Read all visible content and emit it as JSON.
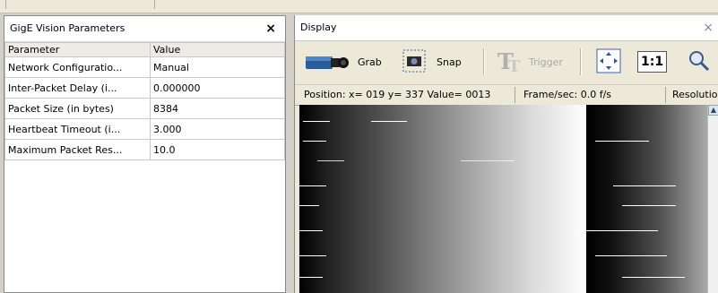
{
  "left_panel": {
    "title": "GigE Vision Parameters",
    "close_glyph": "×",
    "columns": [
      "Parameter",
      "Value"
    ],
    "rows": [
      {
        "param": "Network Configuratio...",
        "value": "Manual"
      },
      {
        "param": "Inter-Packet Delay (i...",
        "value": "0.000000"
      },
      {
        "param": "Packet Size (in bytes)",
        "value": "8384"
      },
      {
        "param": "Heartbeat Timeout (i...",
        "value": "3.000"
      },
      {
        "param": "Maximum Packet Res...",
        "value": "10.0"
      }
    ]
  },
  "right_panel": {
    "title": "Display",
    "close_glyph": "×",
    "toolbar": {
      "grab_label": "Grab",
      "snap_label": "Snap",
      "trigger_label": "Trigger",
      "one_to_one_label": "1:1",
      "icons": [
        "camera-icon",
        "snapshot-icon",
        "trigger-icon",
        "fit-to-window-icon",
        "zoom-icon"
      ]
    },
    "status": {
      "position": "Position:  x= 019 y= 337 Value= 0013",
      "framerate": "Frame/sec:  0.0 f/s",
      "resolution": "Resolutio"
    }
  }
}
